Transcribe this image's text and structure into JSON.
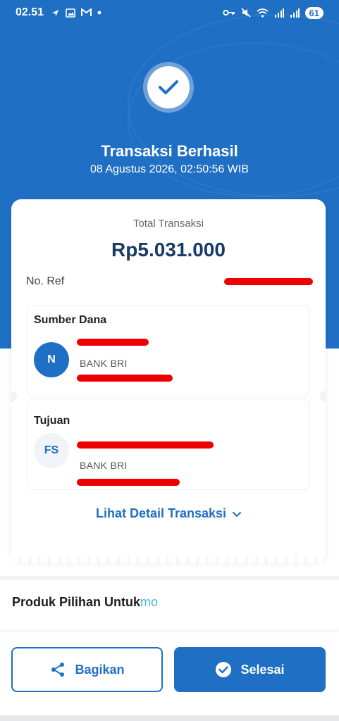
{
  "status_bar": {
    "time": "02.51",
    "left_icons": [
      "navigation-icon",
      "gallery-icon",
      "gmail-icon",
      "dot-icon"
    ],
    "right_icons": [
      "key-icon",
      "mute-icon",
      "wifi-icon",
      "signal-icon",
      "signal-icon"
    ],
    "battery": "61"
  },
  "header": {
    "title": "Transaksi Berhasil",
    "datetime": "08 Agustus 2026, 02:50:56 WIB"
  },
  "summary": {
    "total_label": "Total Transaksi",
    "total_amount": "Rp5.031.000",
    "ref_label": "No. Ref"
  },
  "source": {
    "heading": "Sumber Dana",
    "initials": "N",
    "bank": "BANK BRI"
  },
  "destination": {
    "heading": "Tujuan",
    "initials": "FS",
    "bank": "BANK BRI"
  },
  "detail_link": "Lihat Detail Transaksi",
  "products": {
    "title_main": "Produk Pilihan Untuk",
    "title_accent": "mo"
  },
  "actions": {
    "share_label": "Bagikan",
    "done_label": "Selesai"
  },
  "colors": {
    "primary": "#1f6fc4",
    "redaction": "#ee0000"
  }
}
